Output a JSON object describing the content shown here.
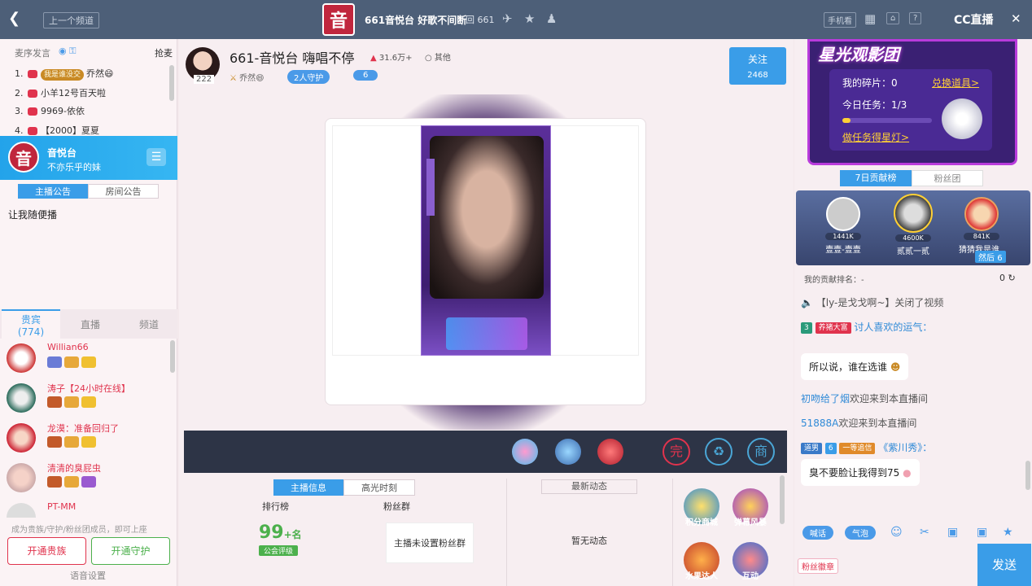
{
  "topbar": {
    "prev_channel": "上一个频道",
    "logo_char": "音",
    "title": "661音悦台 好歌不间断",
    "room_id": "回 661",
    "btn_mobile": "手机看",
    "brand": "CC直播"
  },
  "left": {
    "mic_header": "麦序发言",
    "grab_mic": "抢麦",
    "mic_list": [
      {
        "num": "1.",
        "level": "我是谁没交",
        "name": "乔然😄"
      },
      {
        "num": "2.",
        "level": "",
        "name": "小羊12号百天啦"
      },
      {
        "num": "3.",
        "level": "",
        "name": "9969-依依"
      },
      {
        "num": "4.",
        "level": "",
        "name": "【2000】夏夏"
      }
    ],
    "anchor_logo_char": "音",
    "anchor_name": "音悦台",
    "anchor_slogan": "不亦乐乎的妹",
    "tab_anchor_notice": "主播公告",
    "tab_room_notice": "房间公告",
    "notice_text": "让我随便播",
    "vip_tab": "贵宾",
    "vip_count": "(774)",
    "live_tab": "直播",
    "channel_tab": "频道",
    "vip_list": [
      {
        "name": "Willian66"
      },
      {
        "name": "涛子【24小时在线】"
      },
      {
        "name": "龙漠：准备回归了"
      },
      {
        "name": "清清的臭屁虫"
      },
      {
        "name": "PT-MM"
      }
    ],
    "tip": "成为贵族/守护/粉丝团成员，即可上座",
    "open_noble": "开通贵族",
    "open_guard": "开通守护",
    "voice_settings": "语音设置"
  },
  "center": {
    "fans_count": "222",
    "room_title": "661-音悦台 嗨唱不停",
    "heat": "31.6万+",
    "other": "其他",
    "anchor_name": "乔然😄",
    "guard": "2人守护",
    "fan_count": "6",
    "follow_label": "关注",
    "follow_count": "2468",
    "tab_anchor_info": "主播信息",
    "tab_highlight": "高光时刻",
    "rank_label": "排行榜",
    "fans_group_label": "粉丝群",
    "rank_value": "99",
    "rank_suffix": "+名",
    "union_rank": "公会评级",
    "fans_group_value": "主播未设置粉丝群",
    "latest_label": "最新动态",
    "no_dynamic": "暂无动态",
    "activities": [
      "积分商城",
      "弹幕风暴",
      "水果达人",
      "互动"
    ],
    "gift_icons": [
      "完",
      "eco",
      "商"
    ]
  },
  "right": {
    "star_title": "星光观影团",
    "my_fragments": "我的碎片：0",
    "redeem": "兑换道具>",
    "today_task": "今日任务：1/3",
    "do_task": "做任务得星灯>",
    "tab_7day": "7日贡献榜",
    "tab_fans": "粉丝团",
    "rank": [
      {
        "value": "1441K",
        "name": "壹壹-壹壹"
      },
      {
        "value": "4600K",
        "name": "贰贰一贰"
      },
      {
        "value": "841K",
        "name": "猜猜我是谁..."
      }
    ],
    "rank_badge": "然后",
    "rank_badge_num": "6",
    "my_rank": "我的贡献排名：-",
    "my_rank_value": "0",
    "chat": {
      "sys_msg": "【ly-是戈戈啊~】关闭了视频",
      "msg1_level": "3",
      "msg1_tag": "养猪大富",
      "msg1_name": "讨人喜欢的运气：",
      "bubble1": "所以说，谁在选谁",
      "msg2_name": "初吻给了烟",
      "msg2_text": "欢迎来到本直播间",
      "msg3_name": "51888A",
      "msg3_text": "欢迎来到本直播间",
      "msg4_tag": "道男",
      "msg4_level": "6",
      "msg4_tag2": "一等追信",
      "msg4_name": "《紫川秀》：",
      "bubble2": "臭不要脸让我得到75"
    },
    "pill_shout": "喊话",
    "pill_bubble": "气泡",
    "fans_badge": "粉丝徽章",
    "send": "发送"
  },
  "colors": {
    "topbar": "#4d5f78",
    "accent": "#3a9de8",
    "brand_red": "#c0263d"
  }
}
